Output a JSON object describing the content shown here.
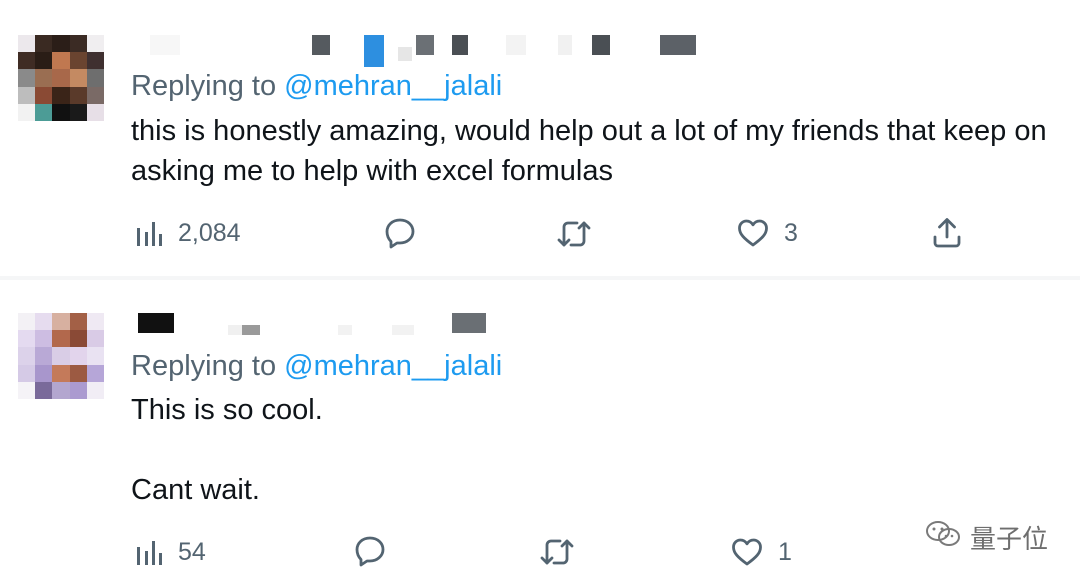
{
  "tweets": [
    {
      "replying_prefix": "Replying to ",
      "replying_handle": "@mehran__jalali",
      "text": "this is honestly amazing, would help out a lot of my friends that keep on asking me to help with excel formulas",
      "views": "2,084",
      "replies": "",
      "retweets": "",
      "likes": "3"
    },
    {
      "replying_prefix": "Replying to ",
      "replying_handle": "@mehran__jalali",
      "text": "This is so cool.\n\nCant wait.",
      "views": "54",
      "replies": "",
      "retweets": "",
      "likes": "1"
    }
  ],
  "watermark": {
    "text": "量子位"
  },
  "icons": {
    "views": "bar-chart-icon",
    "reply": "speech-bubble-icon",
    "retweet": "retweet-icon",
    "like": "heart-icon",
    "share": "share-upload-icon"
  },
  "colors": {
    "text": "#0f1419",
    "secondary": "#536471",
    "link": "#1d9bf0",
    "divider": "#f5f6f7"
  }
}
